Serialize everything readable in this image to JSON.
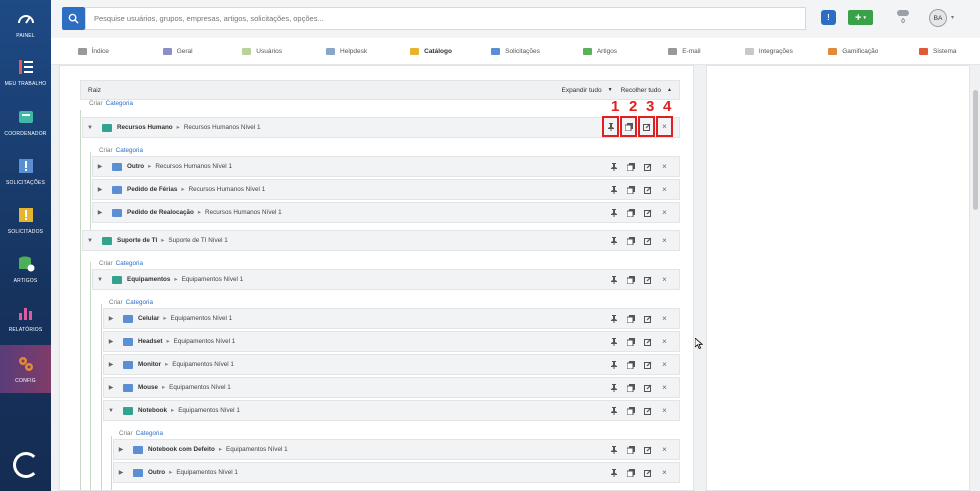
{
  "sidebar": [
    {
      "label": "PAINEL",
      "icon": "gauge-icon"
    },
    {
      "label": "MEU TRABALHO",
      "icon": "list-icon"
    },
    {
      "label": "COORDENADOR",
      "icon": "inbox-icon"
    },
    {
      "label": "SOLICITAÇÕES",
      "icon": "ticket-icon"
    },
    {
      "label": "SOLICITADOS",
      "icon": "ticket-alert-icon"
    },
    {
      "label": "ARTIGOS",
      "icon": "database-icon"
    },
    {
      "label": "RELATÓRIOS",
      "icon": "bar-chart-icon"
    },
    {
      "label": "CONFIG",
      "icon": "gears-icon"
    }
  ],
  "topbar": {
    "search_placeholder": "Pesquise usuários, grupos, empresas, artigos, solicitações, opções...",
    "info": "!",
    "add": "+",
    "notif_count": "0",
    "avatar": "BA"
  },
  "tabs": [
    {
      "label": "Índice",
      "color": "#999"
    },
    {
      "label": "Geral",
      "color": "#8e8ec7"
    },
    {
      "label": "Usuários",
      "color": "#b9d39b"
    },
    {
      "label": "Helpdesk",
      "color": "#8aa6c7"
    },
    {
      "label": "Catálogo",
      "color": "#e6b42d"
    },
    {
      "label": "Solicitações",
      "color": "#5b8fd3"
    },
    {
      "label": "Artigos",
      "color": "#59b15a"
    },
    {
      "label": "E-mail",
      "color": "#999"
    },
    {
      "label": "Integrações",
      "color": "#c8c8cc"
    },
    {
      "label": "Gamificação",
      "color": "#e08a3a"
    },
    {
      "label": "Sistema",
      "color": "#e05a3a"
    }
  ],
  "tree": {
    "root": "Raiz",
    "expand": "Expandir tudo",
    "collapse": "Recolher tudo",
    "criar": "Criar",
    "categoria": "Categoria",
    "rows": [
      {
        "name": "Recursos Humano",
        "level": "Recursos Humanos Nível 1",
        "color": "#33a38f"
      },
      {
        "name": "Outro",
        "level": "Recursos Humanos Nível 1",
        "color": "#5b8fd3"
      },
      {
        "name": "Pedido de Férias",
        "level": "Recursos Humanos Nível 1",
        "color": "#5b8fd3"
      },
      {
        "name": "Pedido de Realocação",
        "level": "Recursos Humanos Nível 1",
        "color": "#5b8fd3"
      },
      {
        "name": "Suporte de TI",
        "level": "Suporte de TI Nível 1",
        "color": "#33a38f"
      },
      {
        "name": "Equipamentos",
        "level": "Equipamentos Nível 1",
        "color": "#33a38f"
      },
      {
        "name": "Celular",
        "level": "Equipamentos Nível 1",
        "color": "#5b8fd3"
      },
      {
        "name": "Headset",
        "level": "Equipamentos Nível 1",
        "color": "#5b8fd3"
      },
      {
        "name": "Monitor",
        "level": "Equipamentos Nível 1",
        "color": "#5b8fd3"
      },
      {
        "name": "Mouse",
        "level": "Equipamentos Nível 1",
        "color": "#5b8fd3"
      },
      {
        "name": "Notebook",
        "level": "Equipamentos Nível 1",
        "color": "#33a38f"
      },
      {
        "name": "Notebook com Defeito",
        "level": "Equipamentos Nível 1",
        "color": "#5b8fd3"
      },
      {
        "name": "Outro",
        "level": "Equipamentos Nível 1",
        "color": "#5b8fd3"
      }
    ]
  },
  "annotations": [
    "1",
    "2",
    "3",
    "4"
  ]
}
